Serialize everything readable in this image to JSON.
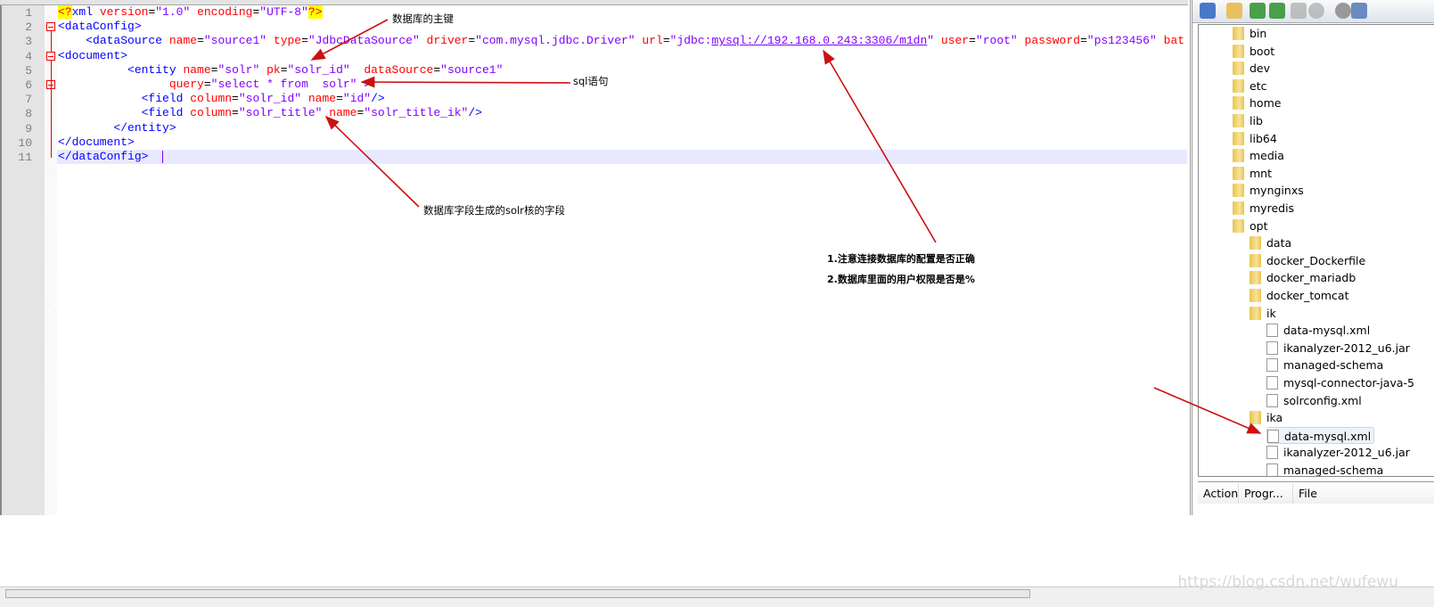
{
  "editor": {
    "lines": [
      [
        [
          "pi",
          "<?"
        ],
        [
          "tag",
          "xml "
        ],
        [
          "attr",
          "version"
        ],
        [
          "eq",
          "="
        ],
        [
          "val",
          "\"1.0\" "
        ],
        [
          "attr",
          "encoding"
        ],
        [
          "eq",
          "="
        ],
        [
          "val",
          "\"UTF-8\""
        ],
        [
          "pi",
          "?>"
        ]
      ],
      [
        [
          "tag",
          "<dataConfig>"
        ]
      ],
      [
        [
          "ws",
          "    "
        ],
        [
          "tag",
          "<dataSource "
        ],
        [
          "attr",
          "name"
        ],
        [
          "eq",
          "="
        ],
        [
          "val",
          "\"source1\" "
        ],
        [
          "attr",
          "type"
        ],
        [
          "eq",
          "="
        ],
        [
          "val",
          "\"JdbcDataSource\" "
        ],
        [
          "attr",
          "driver"
        ],
        [
          "eq",
          "="
        ],
        [
          "val",
          "\"com.mysql.jdbc.Driver\" "
        ],
        [
          "attr",
          "url"
        ],
        [
          "eq",
          "="
        ],
        [
          "val",
          "\"jdbc:"
        ],
        [
          "link",
          "mysql://192.168.0.243:3306/m1dn"
        ],
        [
          "val",
          "\" "
        ],
        [
          "attr",
          "user"
        ],
        [
          "eq",
          "="
        ],
        [
          "val",
          "\"root\" "
        ],
        [
          "attr",
          "password"
        ],
        [
          "eq",
          "="
        ],
        [
          "val",
          "\"ps123456\" "
        ],
        [
          "attr",
          "bat"
        ]
      ],
      [
        [
          "tag",
          "<document>"
        ]
      ],
      [
        [
          "ws",
          "          "
        ],
        [
          "tag",
          "<entity "
        ],
        [
          "attr",
          "name"
        ],
        [
          "eq",
          "="
        ],
        [
          "val",
          "\"solr\" "
        ],
        [
          "attr",
          "pk"
        ],
        [
          "eq",
          "="
        ],
        [
          "val",
          "\"solr_id\"  "
        ],
        [
          "attr",
          "dataSource"
        ],
        [
          "eq",
          "="
        ],
        [
          "val",
          "\"source1\""
        ]
      ],
      [
        [
          "ws",
          "                "
        ],
        [
          "attr",
          "query"
        ],
        [
          "eq",
          "="
        ],
        [
          "val",
          "\"select * from  solr\" "
        ],
        [
          "tag",
          ">"
        ]
      ],
      [
        [
          "ws",
          "            "
        ],
        [
          "tag",
          "<field "
        ],
        [
          "attr",
          "column"
        ],
        [
          "eq",
          "="
        ],
        [
          "val",
          "\"solr_id\" "
        ],
        [
          "attr",
          "name"
        ],
        [
          "eq",
          "="
        ],
        [
          "val",
          "\"id\""
        ],
        [
          "tag",
          "/>"
        ]
      ],
      [
        [
          "ws",
          "            "
        ],
        [
          "tag",
          "<field "
        ],
        [
          "attr",
          "column"
        ],
        [
          "eq",
          "="
        ],
        [
          "val",
          "\"solr_title\" "
        ],
        [
          "attr",
          "name"
        ],
        [
          "eq",
          "="
        ],
        [
          "val",
          "\"solr_title_ik\""
        ],
        [
          "tag",
          "/>"
        ]
      ],
      [
        [
          "ws",
          "        "
        ],
        [
          "tag",
          "</entity>"
        ]
      ],
      [
        [
          "tag",
          "</document>"
        ]
      ],
      [
        [
          "tag",
          "</dataConfig>"
        ]
      ]
    ],
    "line_numbers": [
      "1",
      "2",
      "3",
      "4",
      "5",
      "6",
      "7",
      "8",
      "9",
      "10",
      "11"
    ]
  },
  "annotations": {
    "primary_key": "数据库的主键",
    "sql_statement": "sql语句",
    "field_mapping": "数据库字段生成的solr核的字段",
    "note1": "1.注意连接数据库的配置是否正确",
    "note2": "2.数据库里面的用户权限是否是%"
  },
  "toolbar": {
    "icons": [
      "connect-icon",
      "open-folder-icon",
      "download-icon",
      "upload-icon",
      "refresh-icon",
      "stop-icon",
      "settings-icon",
      "list-view-icon"
    ]
  },
  "tree": {
    "items": [
      {
        "label": "bin",
        "type": "folder",
        "depth": 0
      },
      {
        "label": "boot",
        "type": "folder",
        "depth": 0
      },
      {
        "label": "dev",
        "type": "folder",
        "depth": 0
      },
      {
        "label": "etc",
        "type": "folder",
        "depth": 0
      },
      {
        "label": "home",
        "type": "folder",
        "depth": 0
      },
      {
        "label": "lib",
        "type": "folder",
        "depth": 0
      },
      {
        "label": "lib64",
        "type": "folder",
        "depth": 0
      },
      {
        "label": "media",
        "type": "folder",
        "depth": 0
      },
      {
        "label": "mnt",
        "type": "folder",
        "depth": 0
      },
      {
        "label": "mynginxs",
        "type": "folder",
        "depth": 0
      },
      {
        "label": "myredis",
        "type": "folder",
        "depth": 0
      },
      {
        "label": "opt",
        "type": "folder",
        "depth": 0
      },
      {
        "label": "data",
        "type": "folder",
        "depth": 1
      },
      {
        "label": "docker_Dockerfile",
        "type": "folder",
        "depth": 1
      },
      {
        "label": "docker_mariadb",
        "type": "folder",
        "depth": 1
      },
      {
        "label": "docker_tomcat",
        "type": "folder",
        "depth": 1
      },
      {
        "label": "ik",
        "type": "folder",
        "depth": 1
      },
      {
        "label": "data-mysql.xml",
        "type": "file",
        "depth": 2
      },
      {
        "label": "ikanalyzer-2012_u6.jar",
        "type": "file",
        "depth": 2
      },
      {
        "label": "managed-schema",
        "type": "file",
        "depth": 2
      },
      {
        "label": "mysql-connector-java-5",
        "type": "file",
        "depth": 2
      },
      {
        "label": "solrconfig.xml",
        "type": "file",
        "depth": 2
      },
      {
        "label": "ika",
        "type": "folder",
        "depth": 1
      },
      {
        "label": "data-mysql.xml",
        "type": "file",
        "depth": 2,
        "selected": true
      },
      {
        "label": "ikanalyzer-2012_u6.jar",
        "type": "file",
        "depth": 2
      },
      {
        "label": "managed-schema",
        "type": "file",
        "depth": 2
      }
    ]
  },
  "transfer": {
    "columns": [
      "Action",
      "Progr...",
      "File"
    ]
  },
  "watermark": "https://blog.csdn.net/wufewu",
  "colors": {
    "tag": "#0000ff",
    "attr": "#ff0000",
    "value": "#8000ff",
    "arrow": "#cc1111",
    "current_line": "#e8e8ff"
  }
}
